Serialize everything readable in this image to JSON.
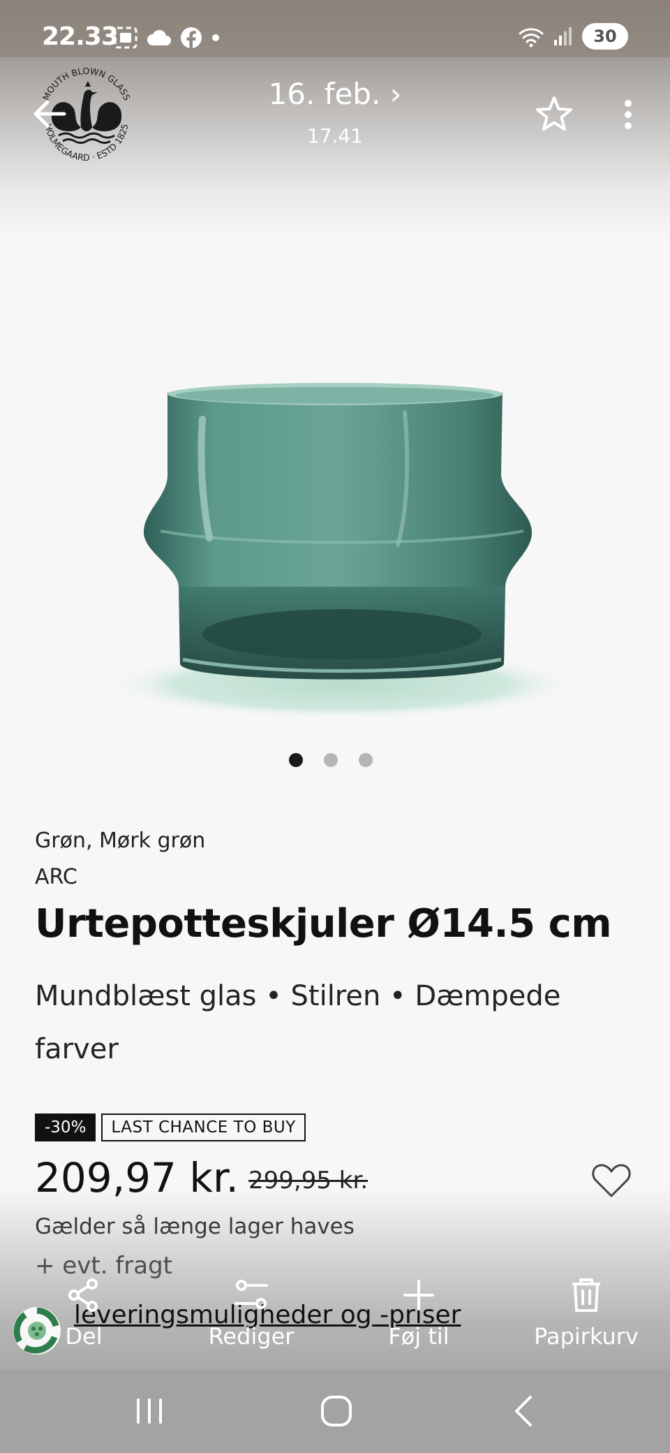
{
  "status_bar": {
    "time": "22.33",
    "battery": "30"
  },
  "header": {
    "date_label": "16. feb. ›",
    "time_label": "17.41",
    "logo": {
      "top_text": "MOUTH BLOWN GLASS",
      "bottom_text": "HOLMEGAARD · ESTD 1825"
    }
  },
  "carousel": {
    "count": 3,
    "active_index": 0
  },
  "product": {
    "color": "Grøn, Mørk grøn",
    "series": "ARC",
    "title": "Urtepotteskjuler Ø14.5 cm",
    "tagline": "Mundblæst glas • Stilren • Dæmpede farver",
    "discount_badge": "-30%",
    "promo_badge": "LAST CHANCE TO BUY",
    "price": "209,97 kr.",
    "old_price": "299,95 kr.",
    "price_note": "Gælder så længe lager haves",
    "shipping_note": "+ evt. fragt",
    "delivery_link": "leveringsmuligheder og -priser"
  },
  "actions": [
    {
      "label": "Del",
      "icon": "share-icon"
    },
    {
      "label": "Rediger",
      "icon": "sliders-icon"
    },
    {
      "label": "Føj til",
      "icon": "plus-icon"
    },
    {
      "label": "Papirkurv",
      "icon": "trash-icon"
    }
  ],
  "nav": {
    "buttons": [
      "recent-apps-icon",
      "home-icon",
      "back-icon"
    ]
  },
  "colors": {
    "glass_green": "#4f8a7e",
    "glass_dark": "#244a44",
    "text": "#111111",
    "badge_bg": "#111111"
  }
}
